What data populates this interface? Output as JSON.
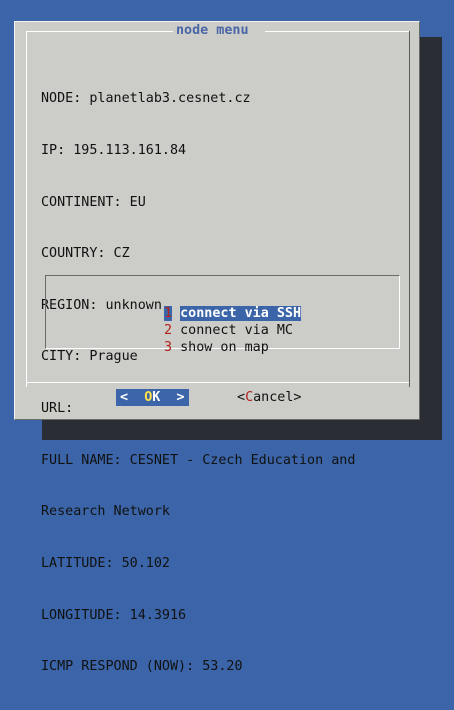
{
  "dialog": {
    "title": "node menu",
    "info_lines": [
      "NODE: planetlab3.cesnet.cz",
      "IP: 195.113.161.84",
      "CONTINENT: EU",
      "COUNTRY: CZ",
      "REGION: unknown",
      "CITY: Prague",
      "URL:",
      "FULL NAME: CESNET - Czech Education and",
      "Research Network",
      "LATITUDE: 50.102",
      "LONGITUDE: 14.3916",
      "ICMP RESPOND (NOW): 53.20"
    ],
    "menu": [
      {
        "tag": "1",
        "label": "connect via SSH",
        "selected": true
      },
      {
        "tag": "2",
        "label": "connect via MC",
        "selected": false
      },
      {
        "tag": "3",
        "label": "show on map",
        "selected": false
      }
    ],
    "buttons": {
      "ok_left": "<  ",
      "ok_hot": "O",
      "ok_rest": "K  >",
      "cancel_left": "<",
      "cancel_hot": "C",
      "cancel_rest": "ancel>"
    }
  },
  "colors": {
    "background": "#3b65a8",
    "dialog": "#cccdc8",
    "title": "#4b66a6",
    "hotkey": "#b3211d",
    "selection": "#3b65a8"
  }
}
